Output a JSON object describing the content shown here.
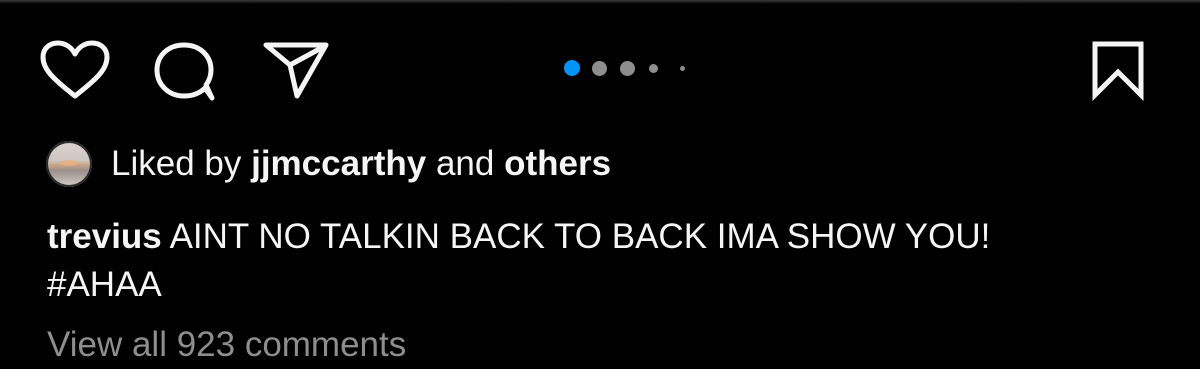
{
  "post": {
    "actions": {
      "like_icon": "heart-outline-icon",
      "comment_icon": "comment-bubble-icon",
      "share_icon": "paper-plane-icon",
      "save_icon": "bookmark-outline-icon"
    },
    "carousel": {
      "active_index": 0,
      "dot_count": 5,
      "active_color": "#0095f6",
      "inactive_color": "#8e8e8e"
    },
    "likes": {
      "prefix": "Liked by",
      "user": "jjmccarthy",
      "connector": "and",
      "others": "others"
    },
    "caption": {
      "username": "trevius",
      "text": "AINT NO TALKIN BACK TO BACK IMA SHOW YOU!",
      "hashtag": "#AHAA"
    },
    "comments": {
      "view_all": "View all 923 comments"
    }
  }
}
